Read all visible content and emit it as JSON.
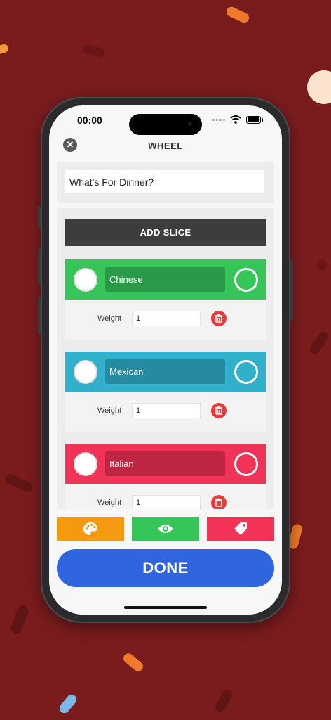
{
  "status_bar": {
    "time": "00:00"
  },
  "header": {
    "title": "WHEEL"
  },
  "wheel_name": {
    "value": "What's For Dinner?"
  },
  "slices_panel": {
    "add_slice_label": "ADD SLICE",
    "weight_label": "Weight",
    "slices": [
      {
        "name": "Chinese",
        "weight": "1",
        "color": "#35c559",
        "name_bg": "#2b9a48"
      },
      {
        "name": "Mexican",
        "weight": "1",
        "color": "#31b0cc",
        "name_bg": "#268aa0"
      },
      {
        "name": "Italian",
        "weight": "1",
        "color": "#f03356",
        "name_bg": "#bf2643"
      }
    ]
  },
  "toolbar": {
    "buttons": [
      {
        "icon": "palette-icon",
        "color": "#f59a10"
      },
      {
        "icon": "eye-icon",
        "color": "#35c559"
      },
      {
        "icon": "tag-icon",
        "color": "#f03356"
      }
    ]
  },
  "done_label": "DONE",
  "colors": {
    "background": "#7a1c1e",
    "done": "#2f66e0",
    "trash": "#ea3a3a"
  }
}
